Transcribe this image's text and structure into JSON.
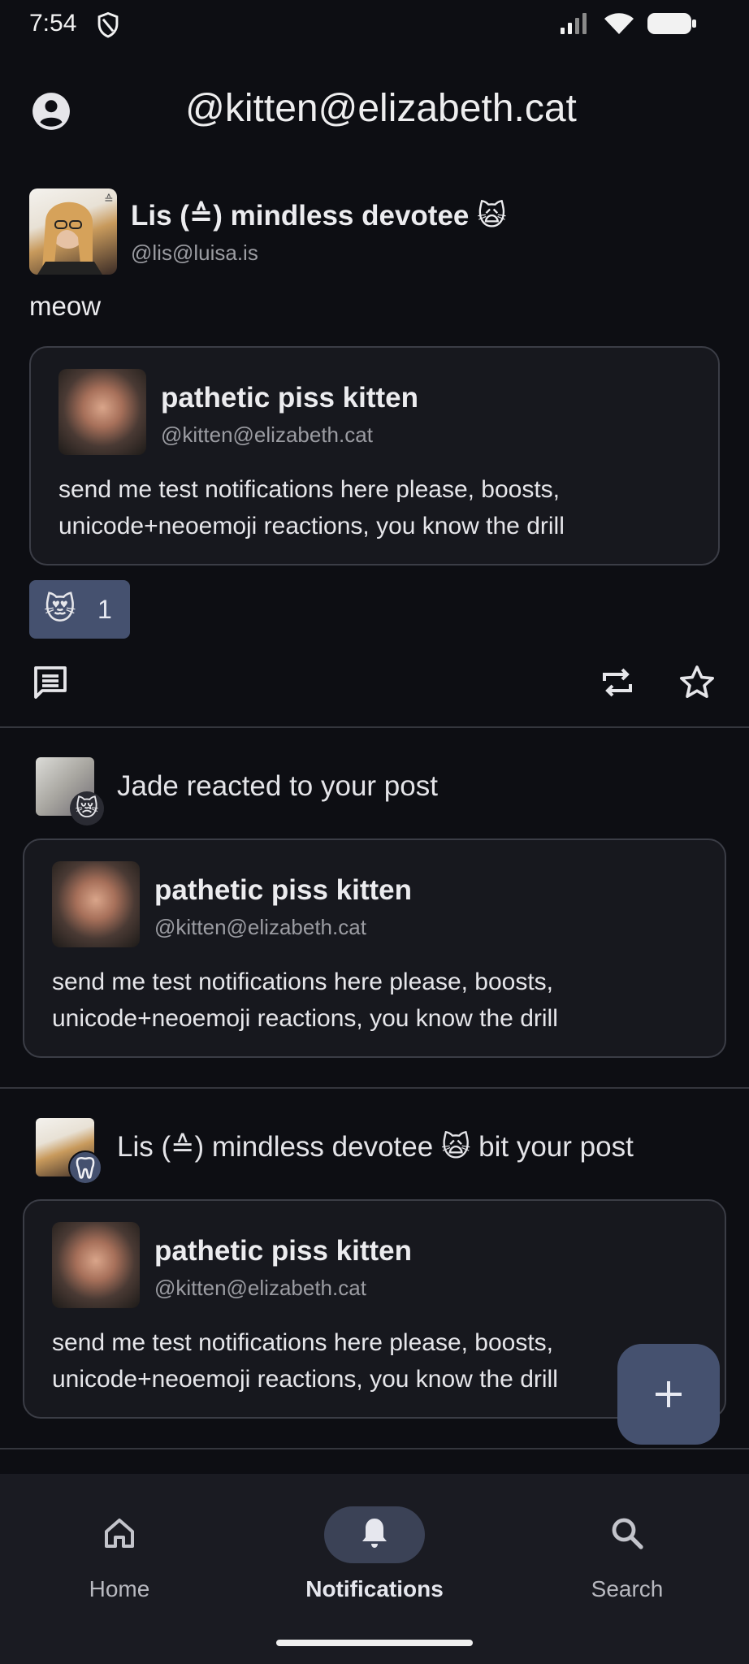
{
  "status_bar": {
    "time": "7:54",
    "icons": [
      "shield-icon",
      "signal-icon",
      "wifi-icon",
      "battery-icon"
    ]
  },
  "header": {
    "title": "@kitten@elizabeth.cat",
    "account_icon": "account-circle-icon"
  },
  "post": {
    "author": {
      "display_name": "Lis (≙) mindless devotee 🙀",
      "handle": "@lis@luisa.is"
    },
    "text": "meow",
    "quote": {
      "display_name": "pathetic piss kitten",
      "handle": "@kitten@elizabeth.cat",
      "body_line1": "send me test notifications here please, boosts,",
      "body_line2": "unicode+neoemoji reactions, you know the drill"
    },
    "reaction": {
      "emoji": "😻",
      "count": "1"
    },
    "actions": [
      "reply-icon",
      "repeat-icon",
      "star-icon"
    ]
  },
  "notifications": [
    {
      "text": "Jade reacted to your post",
      "badge_emoji": "😿",
      "quote": {
        "display_name": "pathetic piss kitten",
        "handle": "@kitten@elizabeth.cat",
        "body_line1": "send me test notifications here please, boosts,",
        "body_line2": "unicode+neoemoji reactions, you know the drill"
      }
    },
    {
      "text": "Lis (≙) mindless devotee 🙀 bit your post",
      "badge_icon": "tooth-icon",
      "quote": {
        "display_name": "pathetic piss kitten",
        "handle": "@kitten@elizabeth.cat",
        "body_line1": "send me test notifications here please, boosts,",
        "body_line2": "unicode+neoemoji reactions, you know the drill"
      }
    }
  ],
  "fab": {
    "label": "+"
  },
  "bottom_nav": {
    "items": [
      {
        "label": "Home",
        "icon": "home-icon"
      },
      {
        "label": "Notifications",
        "icon": "bell-icon",
        "active": true
      },
      {
        "label": "Search",
        "icon": "search-icon"
      }
    ]
  },
  "colors": {
    "background": "#0d0e13",
    "card": "#17181e",
    "accent": "#45516f",
    "nav_background": "#1a1b22"
  }
}
